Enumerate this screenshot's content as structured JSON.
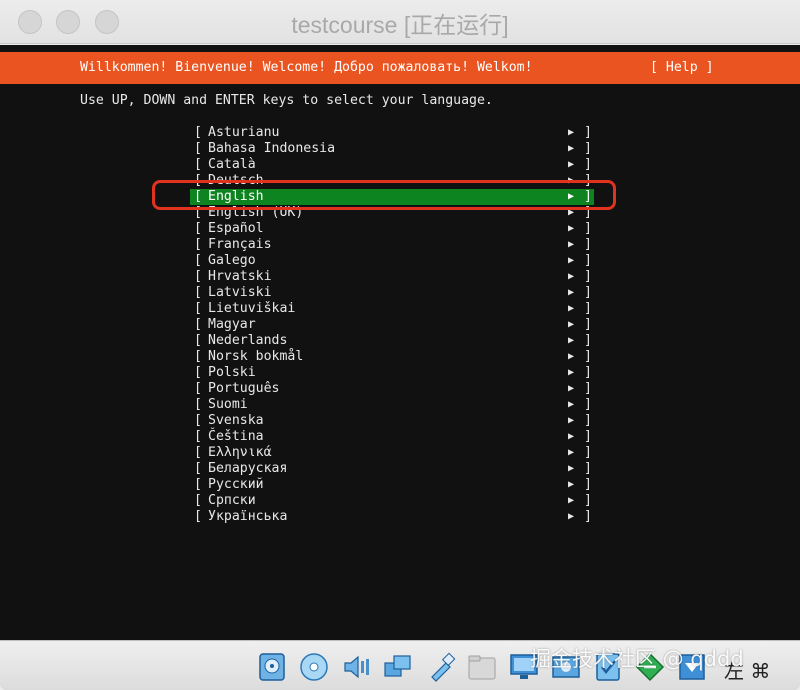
{
  "window": {
    "title": "testcourse [正在运行]"
  },
  "installer": {
    "welcome": "Willkommen! Bienvenue! Welcome! Добро пожаловать! Welkom!",
    "help": "[ Help ]",
    "instruction": "Use UP, DOWN and ENTER keys to select your language.",
    "item_open": "[",
    "item_close": "]",
    "arrow": "▶",
    "languages": [
      "Asturianu",
      "Bahasa Indonesia",
      "Català",
      "Deutsch",
      "English",
      "English (UK)",
      "Español",
      "Français",
      "Galego",
      "Hrvatski",
      "Latviski",
      "Lietuviškai",
      "Magyar",
      "Nederlands",
      "Norsk bokmål",
      "Polski",
      "Português",
      "Suomi",
      "Svenska",
      "Čeština",
      "Ελληνικά",
      "Беларуская",
      "Русский",
      "Српски",
      "Українська"
    ],
    "selected_index": 4
  },
  "colors": {
    "accent": "#e95420",
    "selected": "#0e8420",
    "annotation": "#e0331f"
  },
  "statusbar": {
    "watermark": "掘金技术社区 @ qddd",
    "host_key": "左 ⌘",
    "icons": [
      "hard-disk-icon",
      "optical-drive-icon",
      "audio-icon",
      "network-icon",
      "usb-icon",
      "shared-folder-icon",
      "display-icon",
      "recording-icon",
      "capture-icon",
      "mouse-integration-icon",
      "keyboard-icon"
    ]
  }
}
